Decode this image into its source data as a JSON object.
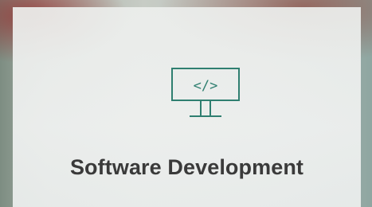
{
  "tile": {
    "title": "Software Development",
    "icon": "monitor-code-icon",
    "icon_glyph": "</>",
    "accent_color": "#2f7f70",
    "title_color": "#3a3a3a"
  }
}
